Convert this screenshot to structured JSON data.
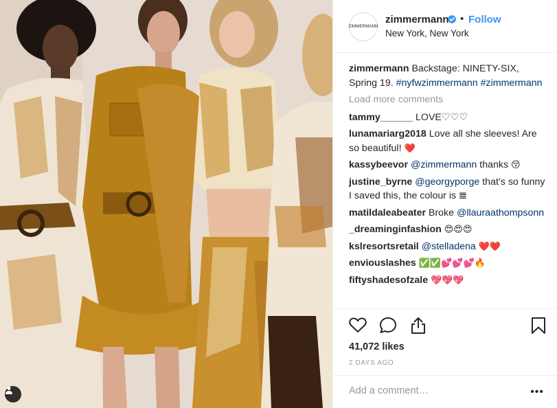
{
  "post": {
    "username": "zimmermann",
    "avatar_text": "ZIMMERMANN",
    "separator": "•",
    "follow_label": "Follow",
    "location": "New York, New York",
    "verified_color": "#3897f0"
  },
  "caption": {
    "user": "zimmermann",
    "text": "Backstage: NINETY-SIX, Spring 19.",
    "tag1": "#nyfwzimmermann",
    "tag2": "#zimmermann"
  },
  "load_more": "Load more comments",
  "comments": [
    {
      "user": "tammy______",
      "text": "LOVE♡♡♡"
    },
    {
      "user": "lunamariarg2018",
      "text": "Love all she sleeves! Are so beautiful!",
      "emoji": "❤️"
    },
    {
      "user": "kassybeevor",
      "mention": "@zimmermann",
      "text": "thanks",
      "emoji": "😚"
    },
    {
      "user": "justine_byrne",
      "mention": "@georgyporge",
      "text": "that’s so funny I saved this, the colour is",
      "emoji": "𝌆"
    },
    {
      "user": "matildaleabeater",
      "text": "Broke",
      "mention": "@llauraathompsonn"
    },
    {
      "user": "_dreaminginfashion",
      "emoji": "😍😍😍"
    },
    {
      "user": "kslresortsretail",
      "mention": "@stelladena",
      "emoji": "❤️❤️"
    },
    {
      "user": "enviouslashes",
      "emoji": "✅✅💕💕💕🔥"
    },
    {
      "user": "fiftyshadesofzale",
      "emoji": "💖💖💖"
    }
  ],
  "likes": "41,072 likes",
  "date": "2 DAYS AGO",
  "add_comment_placeholder": "Add a comment…",
  "more_label": "•••",
  "icons": {
    "like": "heart-icon",
    "comment": "comment-bubble-icon",
    "share": "share-icon",
    "save": "bookmark-icon",
    "tag": "user-tag-icon"
  }
}
